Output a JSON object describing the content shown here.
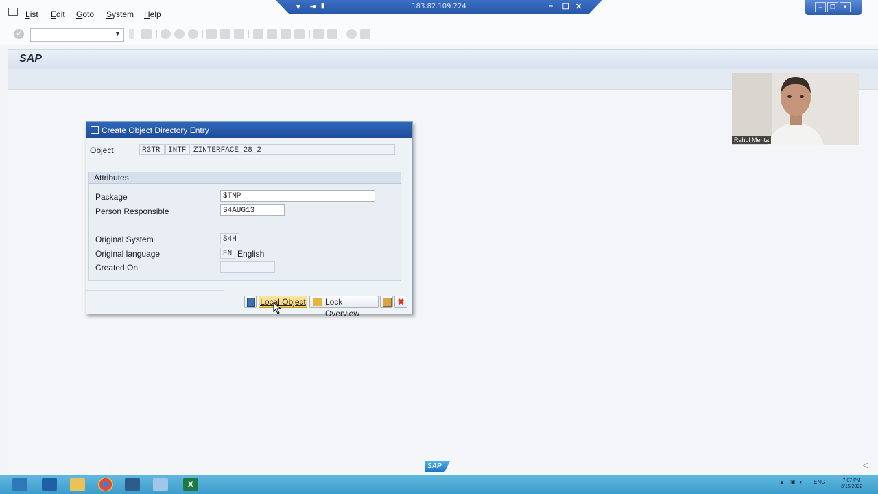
{
  "menu": [
    "List",
    "Edit",
    "Goto",
    "System",
    "Help"
  ],
  "remote_session": {
    "ip": "183.82.109.224"
  },
  "app": {
    "title": "SAP"
  },
  "dialog": {
    "title": "Create Object Directory Entry",
    "object_label": "Object",
    "object_fields": [
      "R3TR",
      "INTF",
      "ZINTERFACE_28_2"
    ],
    "attributes_header": "Attributes",
    "fields": {
      "package": {
        "label": "Package",
        "value": "$TMP"
      },
      "person": {
        "label": "Person Responsible",
        "value": "S4AUG13"
      },
      "original_system": {
        "label": "Original System",
        "value": "S4H"
      },
      "original_language": {
        "label": "Original language",
        "code": "EN",
        "text": "English"
      },
      "created_on": {
        "label": "Created On",
        "value": ""
      }
    },
    "buttons": {
      "local_object": "Local Object",
      "lock_overview": "Lock Overview"
    }
  },
  "webcam": {
    "name": "Rahul Mehta"
  },
  "footer": {
    "brand": "SAP"
  },
  "taskbar": {
    "language": "ENG",
    "time": "7:07 PM",
    "date": "3/15/2022"
  },
  "colors": {
    "accent": "#1d4d9a",
    "highlight_button": "#f5d77a",
    "cancel": "#d8322b"
  }
}
